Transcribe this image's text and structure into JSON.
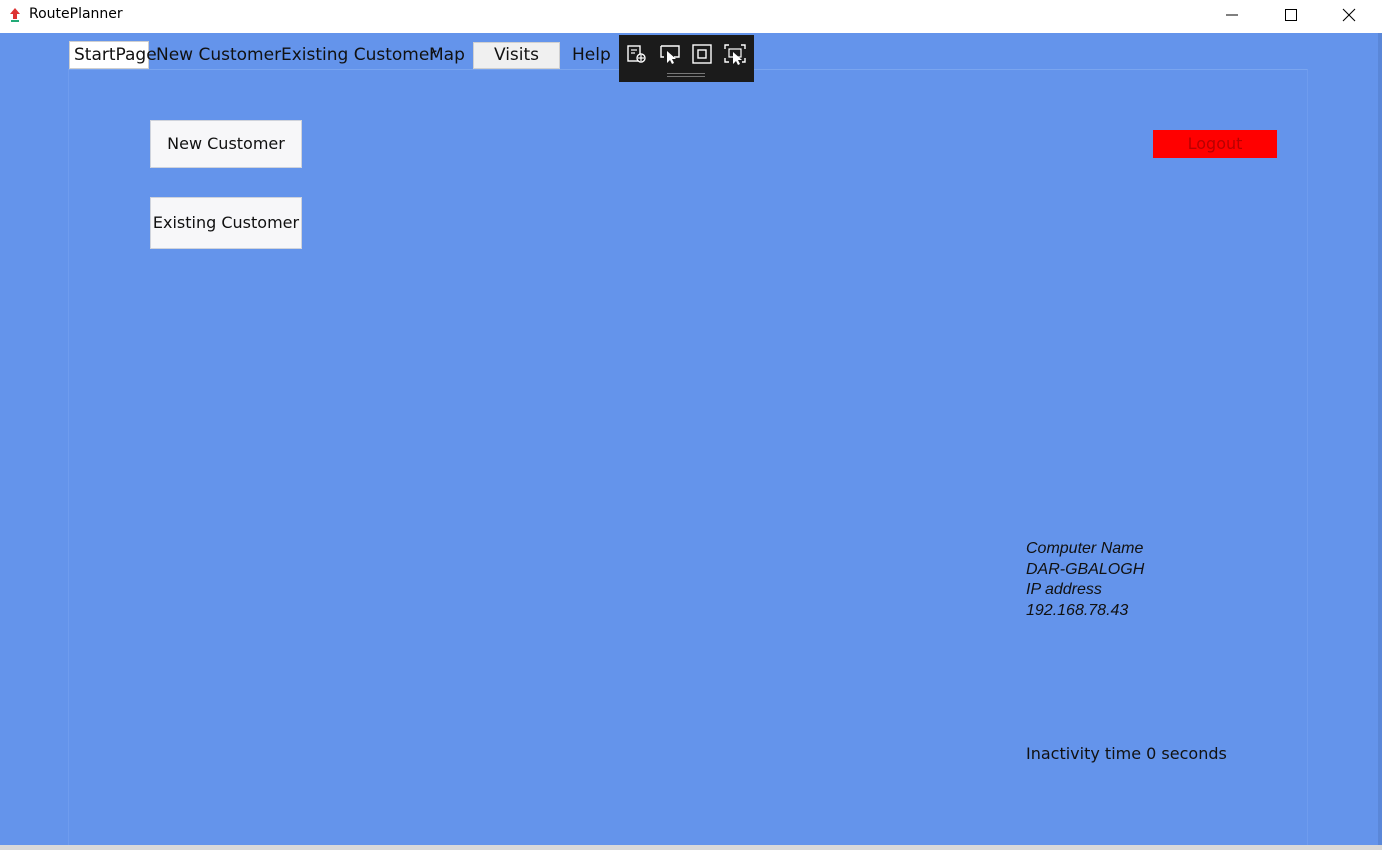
{
  "window": {
    "title": "RoutePlanner",
    "controls": [
      "minimize-icon",
      "maximize-icon",
      "close-icon"
    ]
  },
  "tabs": [
    {
      "label": "StartPage",
      "selected": true
    },
    {
      "label": "New Customer",
      "selected": false
    },
    {
      "label": "Existing Customer",
      "selected": false
    },
    {
      "label": "Map",
      "selected": false
    },
    {
      "label": "Visits",
      "selected": false
    },
    {
      "label": "Help",
      "selected": false
    }
  ],
  "debug_toolbar": {
    "icons": [
      "live-visual-tree-icon",
      "select-element-icon",
      "display-layout-adorners-icon",
      "track-focused-element-icon"
    ]
  },
  "main": {
    "new_customer_button": "New Customer",
    "existing_customer_button": "Existing Customer",
    "logout_button": "Logout"
  },
  "info": {
    "computer_name_label": "Computer Name",
    "computer_name": "DAR-GBALOGH",
    "ip_label": "IP address",
    "ip": "192.168.78.43"
  },
  "status": {
    "inactivity": "Inactivity time 0 seconds"
  },
  "colors": {
    "background": "#6494eb",
    "logout_bg": "#ff0000",
    "logout_text": "#b80000",
    "toolbar_bg": "#1b1b1b"
  }
}
